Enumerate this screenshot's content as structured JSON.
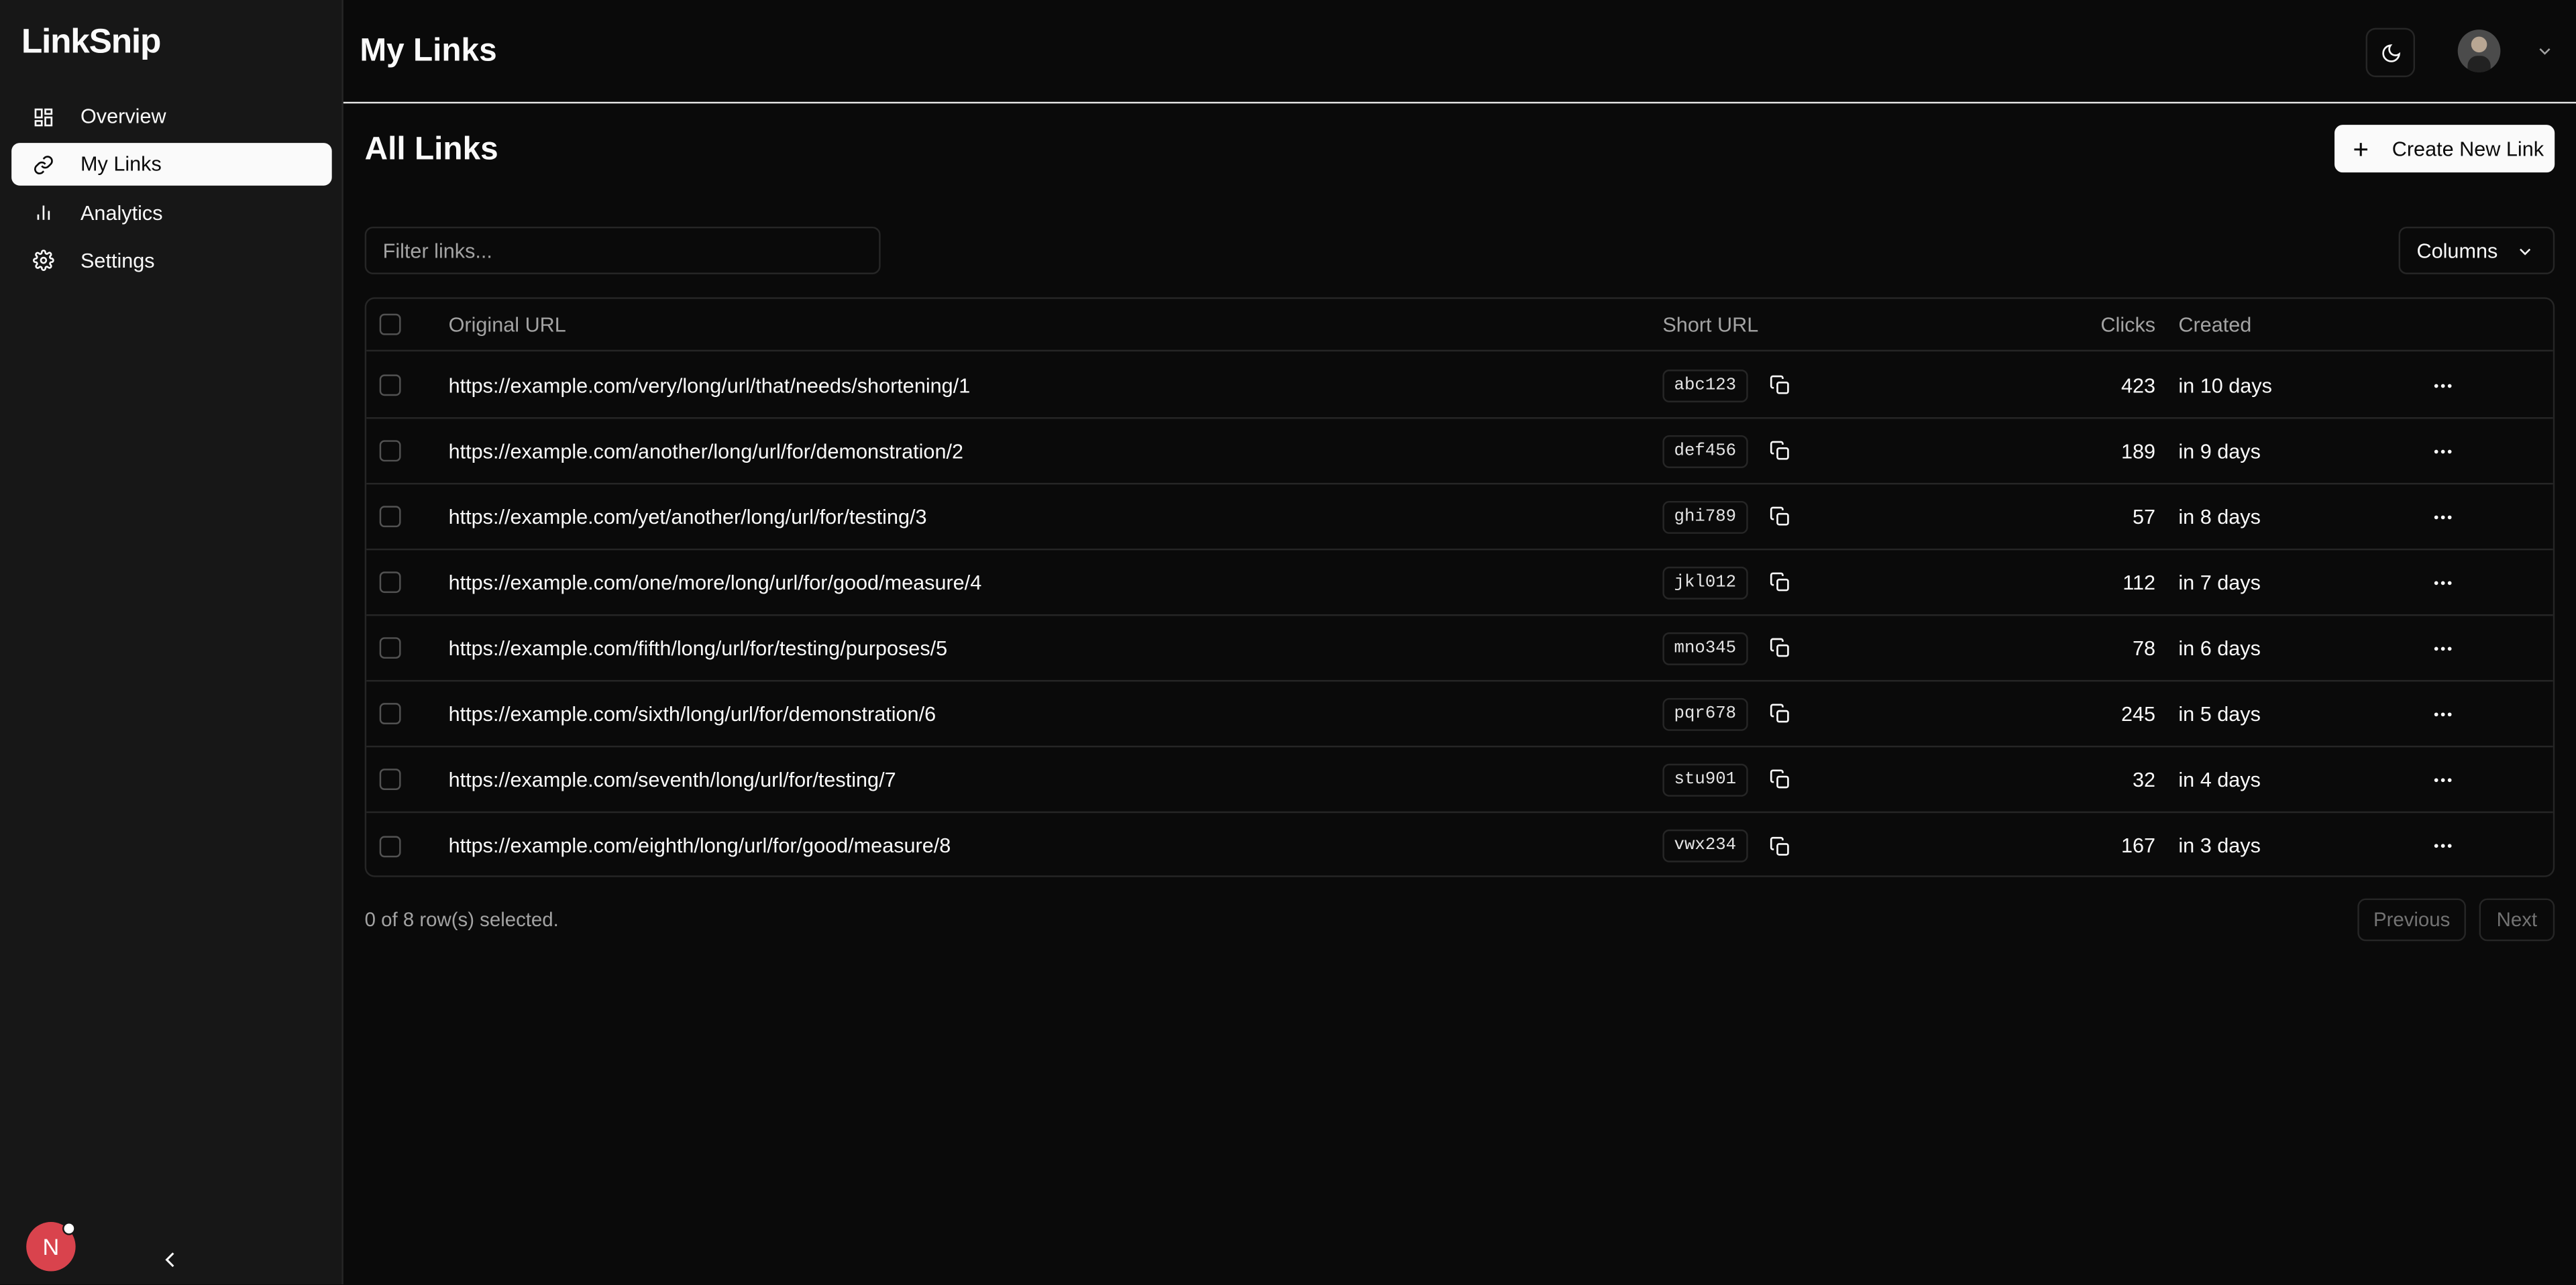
{
  "app": {
    "name": "LinkSnip"
  },
  "sidebar": {
    "items": [
      {
        "label": "Overview",
        "icon": "dashboard-icon"
      },
      {
        "label": "My Links",
        "icon": "link-icon",
        "active": true
      },
      {
        "label": "Analytics",
        "icon": "bar-chart-icon"
      },
      {
        "label": "Settings",
        "icon": "gear-icon"
      }
    ],
    "user_initial": "N"
  },
  "header": {
    "title": "My Links"
  },
  "main": {
    "title": "All Links",
    "create_label": "Create New Link",
    "filter_placeholder": "Filter links...",
    "columns_label": "Columns",
    "table": {
      "headers": {
        "original": "Original URL",
        "short": "Short URL",
        "clicks": "Clicks",
        "created": "Created"
      },
      "rows": [
        {
          "original": "https://example.com/very/long/url/that/needs/shortening/1",
          "short": "abc123",
          "clicks": "423",
          "created": "in 10 days"
        },
        {
          "original": "https://example.com/another/long/url/for/demonstration/2",
          "short": "def456",
          "clicks": "189",
          "created": "in 9 days"
        },
        {
          "original": "https://example.com/yet/another/long/url/for/testing/3",
          "short": "ghi789",
          "clicks": "57",
          "created": "in 8 days"
        },
        {
          "original": "https://example.com/one/more/long/url/for/good/measure/4",
          "short": "jkl012",
          "clicks": "112",
          "created": "in 7 days"
        },
        {
          "original": "https://example.com/fifth/long/url/for/testing/purposes/5",
          "short": "mno345",
          "clicks": "78",
          "created": "in 6 days"
        },
        {
          "original": "https://example.com/sixth/long/url/for/demonstration/6",
          "short": "pqr678",
          "clicks": "245",
          "created": "in 5 days"
        },
        {
          "original": "https://example.com/seventh/long/url/for/testing/7",
          "short": "stu901",
          "clicks": "32",
          "created": "in 4 days"
        },
        {
          "original": "https://example.com/eighth/long/url/for/good/measure/8",
          "short": "vwx234",
          "clicks": "167",
          "created": "in 3 days"
        }
      ]
    },
    "selection_text": "0 of 8 row(s) selected.",
    "pagination": {
      "previous": "Previous",
      "next": "Next"
    }
  },
  "colors": {
    "background": "#0a0a0a",
    "sidebar": "#171717",
    "border": "#262626",
    "accent": "#fafafa",
    "avatar": "#d9434d"
  }
}
